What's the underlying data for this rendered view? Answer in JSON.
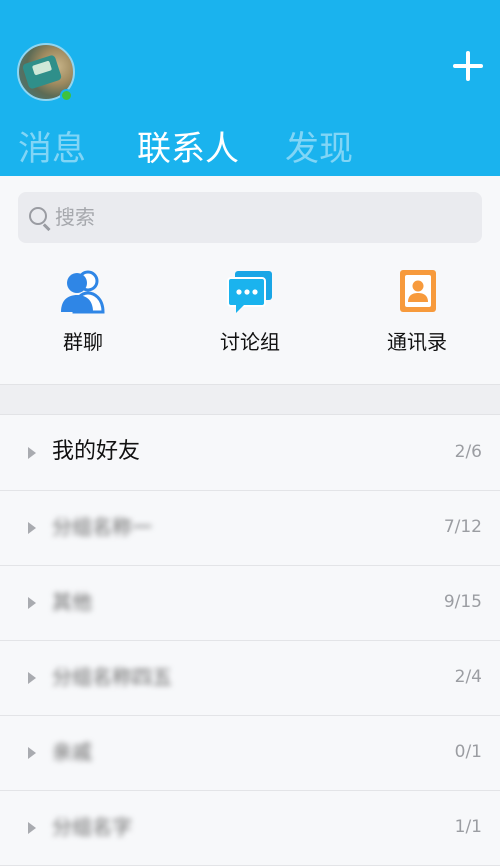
{
  "header": {
    "plus_icon": "plus-icon",
    "accent_color": "#1ab3ee",
    "online_color": "#3ec23e"
  },
  "tabs": [
    {
      "label": "消息",
      "active": false
    },
    {
      "label": "联系人",
      "active": true
    },
    {
      "label": "发现",
      "active": false
    }
  ],
  "search": {
    "placeholder": "搜索",
    "icon": "search-icon"
  },
  "quick_actions": [
    {
      "label": "群聊",
      "icon": "group-chat-icon"
    },
    {
      "label": "讨论组",
      "icon": "discussion-icon"
    },
    {
      "label": "通讯录",
      "icon": "address-book-icon"
    }
  ],
  "groups": [
    {
      "name": "我的好友",
      "count": "2/6"
    },
    {
      "name": "分组名称一",
      "count": "7/12"
    },
    {
      "name": "其他",
      "count": "9/15"
    },
    {
      "name": "分组名称四五",
      "count": "2/4"
    },
    {
      "name": "亲戚",
      "count": "0/1"
    },
    {
      "name": "分组名字",
      "count": "1/1"
    }
  ]
}
